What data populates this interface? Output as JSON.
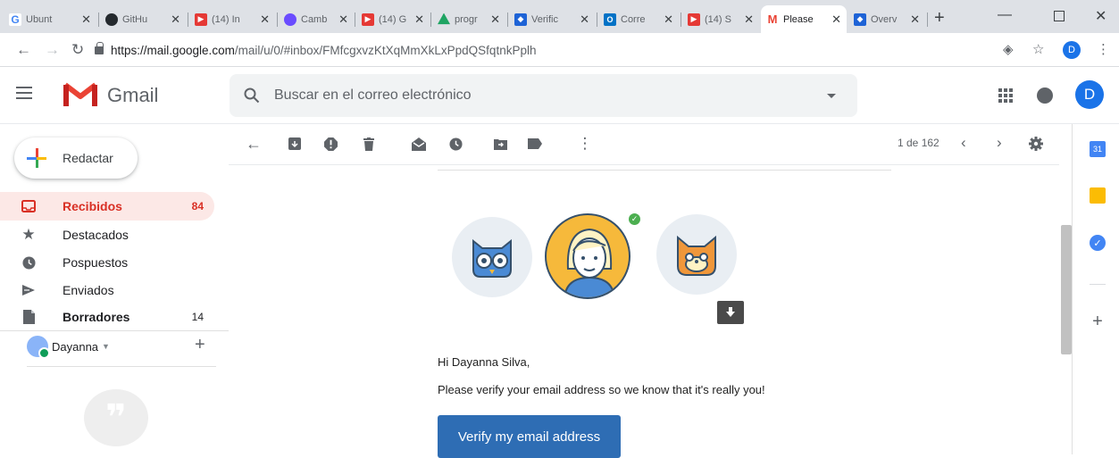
{
  "browser": {
    "tabs": [
      {
        "title": "Ubunt",
        "favicon": "g-icon",
        "color": "#4285f4"
      },
      {
        "title": "GitHu",
        "favicon": "github-icon",
        "color": "#24292e"
      },
      {
        "title": "(14) In",
        "favicon": "youtube-icon",
        "color": "#e53935"
      },
      {
        "title": "Camb",
        "favicon": "campfire-icon",
        "color": "#6a4cff"
      },
      {
        "title": "(14) G",
        "favicon": "youtube-icon",
        "color": "#e53935"
      },
      {
        "title": "progr",
        "favicon": "drive-icon",
        "color": "#1fa463"
      },
      {
        "title": "Verific",
        "favicon": "jira-icon",
        "color": "#1e63d6"
      },
      {
        "title": "Corre",
        "favicon": "outlook-icon",
        "color": "#0072c6"
      },
      {
        "title": "(14) S",
        "favicon": "youtube-icon",
        "color": "#e53935"
      },
      {
        "title": "Please",
        "favicon": "gmail-icon",
        "color": "#ea4335",
        "active": true
      },
      {
        "title": "Overv",
        "favicon": "jira-icon",
        "color": "#1e63d6"
      }
    ],
    "url_host": "https://mail.google.com",
    "url_path": "/mail/u/0/#inbox/FMfcgxvzKtXqMmXkLxPpdQSfqtnkPplh",
    "profile_letter": "D"
  },
  "gmail": {
    "app_name": "Gmail",
    "search_placeholder": "Buscar en el correo electrónico",
    "avatar_letter": "D",
    "compose_label": "Redactar",
    "nav": [
      {
        "label": "Recibidos",
        "count": "84",
        "icon": "inbox-icon",
        "active": true
      },
      {
        "label": "Destacados",
        "count": "",
        "icon": "star-icon"
      },
      {
        "label": "Pospuestos",
        "count": "",
        "icon": "clock-icon"
      },
      {
        "label": "Enviados",
        "count": "",
        "icon": "send-icon"
      },
      {
        "label": "Borradores",
        "count": "14",
        "icon": "draft-icon",
        "bold": true
      }
    ],
    "hangouts_user": "Dayanna",
    "pager": "1 de 162"
  },
  "email": {
    "greeting": "Hi Dayanna Silva,",
    "body": "Please verify your email address so we know that it's really you!",
    "button": "Verify my email address"
  },
  "colors": {
    "accent_red": "#d93025",
    "button_blue": "#2e6db4",
    "active_nav_bg": "#fce8e6"
  }
}
